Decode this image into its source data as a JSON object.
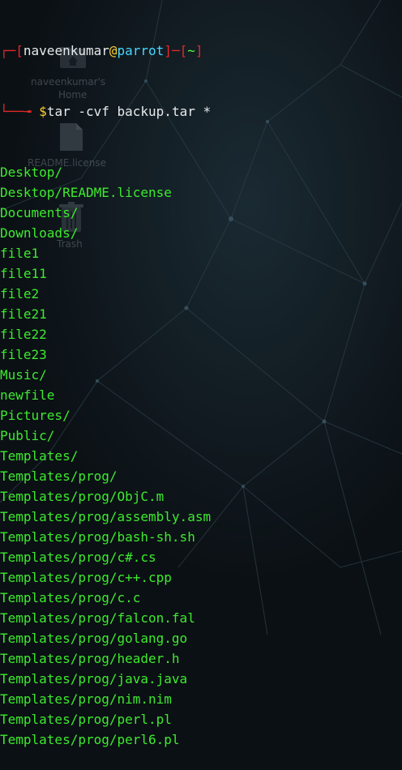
{
  "prompt": {
    "user": "naveenkumar",
    "at": "@",
    "host": "parrot",
    "cwd": "~",
    "dollar": "$",
    "command": "tar -cvf backup.tar *"
  },
  "output_lines": [
    "Desktop/",
    "Desktop/README.license",
    "Documents/",
    "Downloads/",
    "file1",
    "file11",
    "file2",
    "file21",
    "file22",
    "file23",
    "Music/",
    "newfile",
    "Pictures/",
    "Public/",
    "Templates/",
    "Templates/prog/",
    "Templates/prog/ObjC.m",
    "Templates/prog/assembly.asm",
    "Templates/prog/bash-sh.sh",
    "Templates/prog/c#.cs",
    "Templates/prog/c++.cpp",
    "Templates/prog/c.c",
    "Templates/prog/falcon.fal",
    "Templates/prog/golang.go",
    "Templates/prog/header.h",
    "Templates/prog/java.java",
    "Templates/prog/nim.nim",
    "Templates/prog/perl.pl",
    "Templates/prog/perl6.pl"
  ],
  "desktop": {
    "home_label": "naveenkumar's",
    "home_sublabel": "Home",
    "file_label": "README.license",
    "trash_label": "Trash"
  },
  "colors": {
    "background": "#0b1014",
    "prompt_bracket": "#e02a2a",
    "username": "#e7eaec",
    "at_sign": "#ffcf2a",
    "hostname": "#47d7ff",
    "path": "#5cff3a",
    "output_text": "#3dea2e"
  }
}
